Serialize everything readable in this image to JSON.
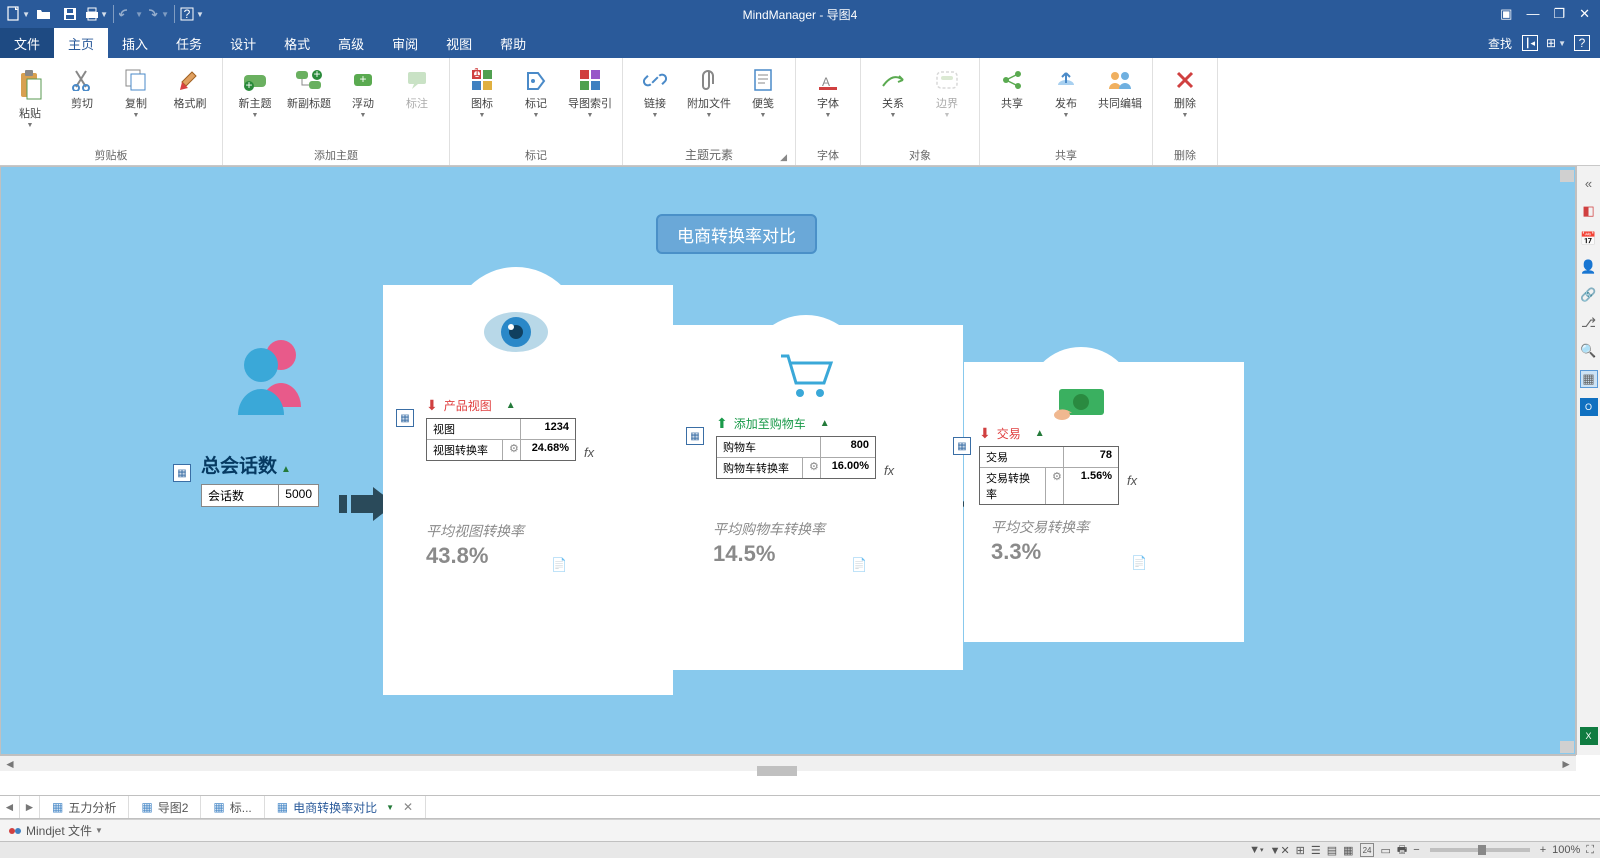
{
  "app": {
    "title": "MindManager - 导图4"
  },
  "menus": {
    "file": "文件",
    "home": "主页",
    "insert": "插入",
    "task": "任务",
    "design": "设计",
    "format": "格式",
    "advanced": "高级",
    "review": "审阅",
    "view": "视图",
    "help": "帮助",
    "search": "查找"
  },
  "ribbon": {
    "groups": {
      "clipboard": "剪贴板",
      "addTopic": "添加主题",
      "markers": "标记",
      "topicElem": "主题元素",
      "font": "字体",
      "object": "对象",
      "share": "共享",
      "delete": "删除"
    },
    "btns": {
      "paste": "粘贴",
      "cut": "剪切",
      "copy": "复制",
      "formatPainter": "格式刷",
      "newTopic": "新主题",
      "newSubtopic": "新副标题",
      "float": "浮动",
      "callout": "标注",
      "icon": "图标",
      "tag": "标记",
      "mapIndex": "导图索引",
      "link": "链接",
      "attach": "附加文件",
      "note": "便笺",
      "font": "字体",
      "relation": "关系",
      "boundary": "边界",
      "share": "共享",
      "publish": "发布",
      "coedit": "共同编辑",
      "delete": "删除"
    }
  },
  "diagram": {
    "title": "电商转换率对比",
    "sessions": {
      "title": "总会话数",
      "label": "会话数",
      "value": "5000"
    },
    "steps": [
      {
        "title": "产品视图",
        "color": "red",
        "arrow": "down",
        "rows": [
          {
            "k": "视图",
            "v": "1234"
          },
          {
            "k": "视图转换率",
            "gear": true,
            "v": "24.68%"
          }
        ],
        "avgLabel": "平均视图转换率",
        "avgVal": "43.8%"
      },
      {
        "title": "添加至购物车",
        "color": "green",
        "arrow": "up",
        "rows": [
          {
            "k": "购物车",
            "v": "800"
          },
          {
            "k": "购物车转换率",
            "gear": true,
            "v": "16.00%"
          }
        ],
        "avgLabel": "平均购物车转换率",
        "avgVal": "14.5%"
      },
      {
        "title": "交易",
        "color": "red",
        "arrow": "down",
        "rows": [
          {
            "k": "交易",
            "v": "78"
          },
          {
            "k": "交易转换率",
            "gear": true,
            "v": "1.56%"
          }
        ],
        "avgLabel": "平均交易转换率",
        "avgVal": "3.3%"
      }
    ],
    "fx": "fx"
  },
  "doctabs": [
    {
      "label": "五力分析",
      "active": false
    },
    {
      "label": "导图2",
      "active": false
    },
    {
      "label": "标...",
      "active": false
    },
    {
      "label": "电商转换率对比",
      "active": true
    }
  ],
  "status": {
    "mindjet": "Mindjet 文件",
    "zoom": "100%"
  }
}
